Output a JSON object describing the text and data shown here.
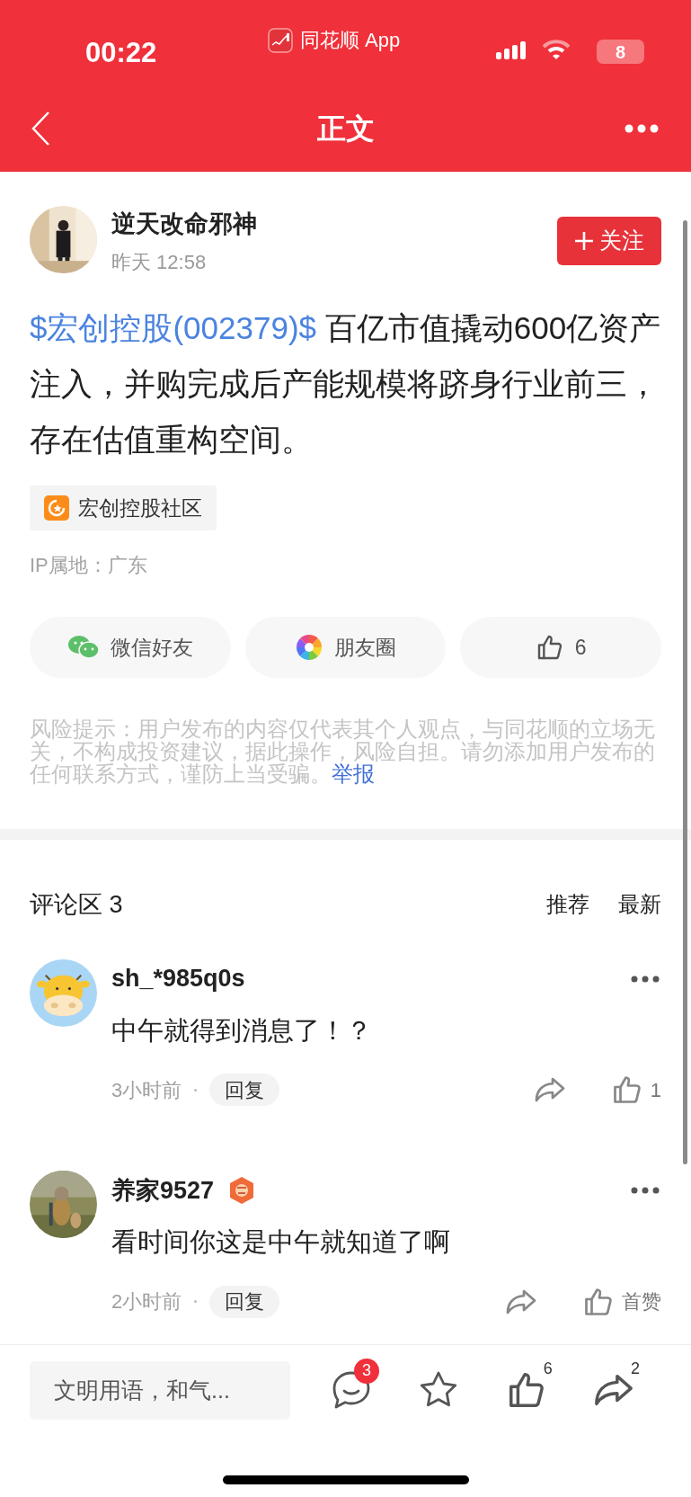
{
  "status_bar": {
    "time": "00:22",
    "app_label": "同花顺 App",
    "battery": "8"
  },
  "nav": {
    "title": "正文"
  },
  "post": {
    "author": "逆天改命邪神",
    "time": "昨天 12:58",
    "follow_label": "关注",
    "stock_link": "$宏创控股(002379)$",
    "text": "百亿市值撬动600亿资产注入，并购完成后产能规模将跻身行业前三，存在估值重构空间。",
    "community": "宏创控股社区",
    "ip": "IP属地：广东",
    "share": [
      {
        "kind": "wechat",
        "label": "微信好友"
      },
      {
        "kind": "moments",
        "label": "朋友圈"
      },
      {
        "kind": "like",
        "label": "6"
      }
    ],
    "risk_notice": "风险提示：用户发布的内容仅代表其个人观点，与同花顺的立场无关，不构成投资建议，据此操作，风险自担。请勿添加用户发布的任何联系方式，谨防上当受骗。",
    "report_link": "举报"
  },
  "comments_header": {
    "title": "评论区 3",
    "sort_options": [
      "推荐",
      "最新"
    ]
  },
  "comments": [
    {
      "avatar": {
        "kind": "cartoon"
      },
      "user": "sh_*985q0s",
      "badge": false,
      "text": "中午就得到消息了！？",
      "time": "3小时前",
      "reply_label": "回复",
      "like_label": "1"
    },
    {
      "user": "养家9527",
      "badge": true,
      "text": "看时间你这是中午就知道了啊",
      "time": "2小时前",
      "reply_label": "回复",
      "like_label": "首赞"
    }
  ],
  "bottom_bar": {
    "placeholder": "文明用语，和气...",
    "actions": [
      {
        "kind": "comment",
        "count": "3"
      },
      {
        "kind": "star"
      },
      {
        "kind": "like",
        "count": "6"
      },
      {
        "kind": "share",
        "count": "2"
      }
    ]
  }
}
